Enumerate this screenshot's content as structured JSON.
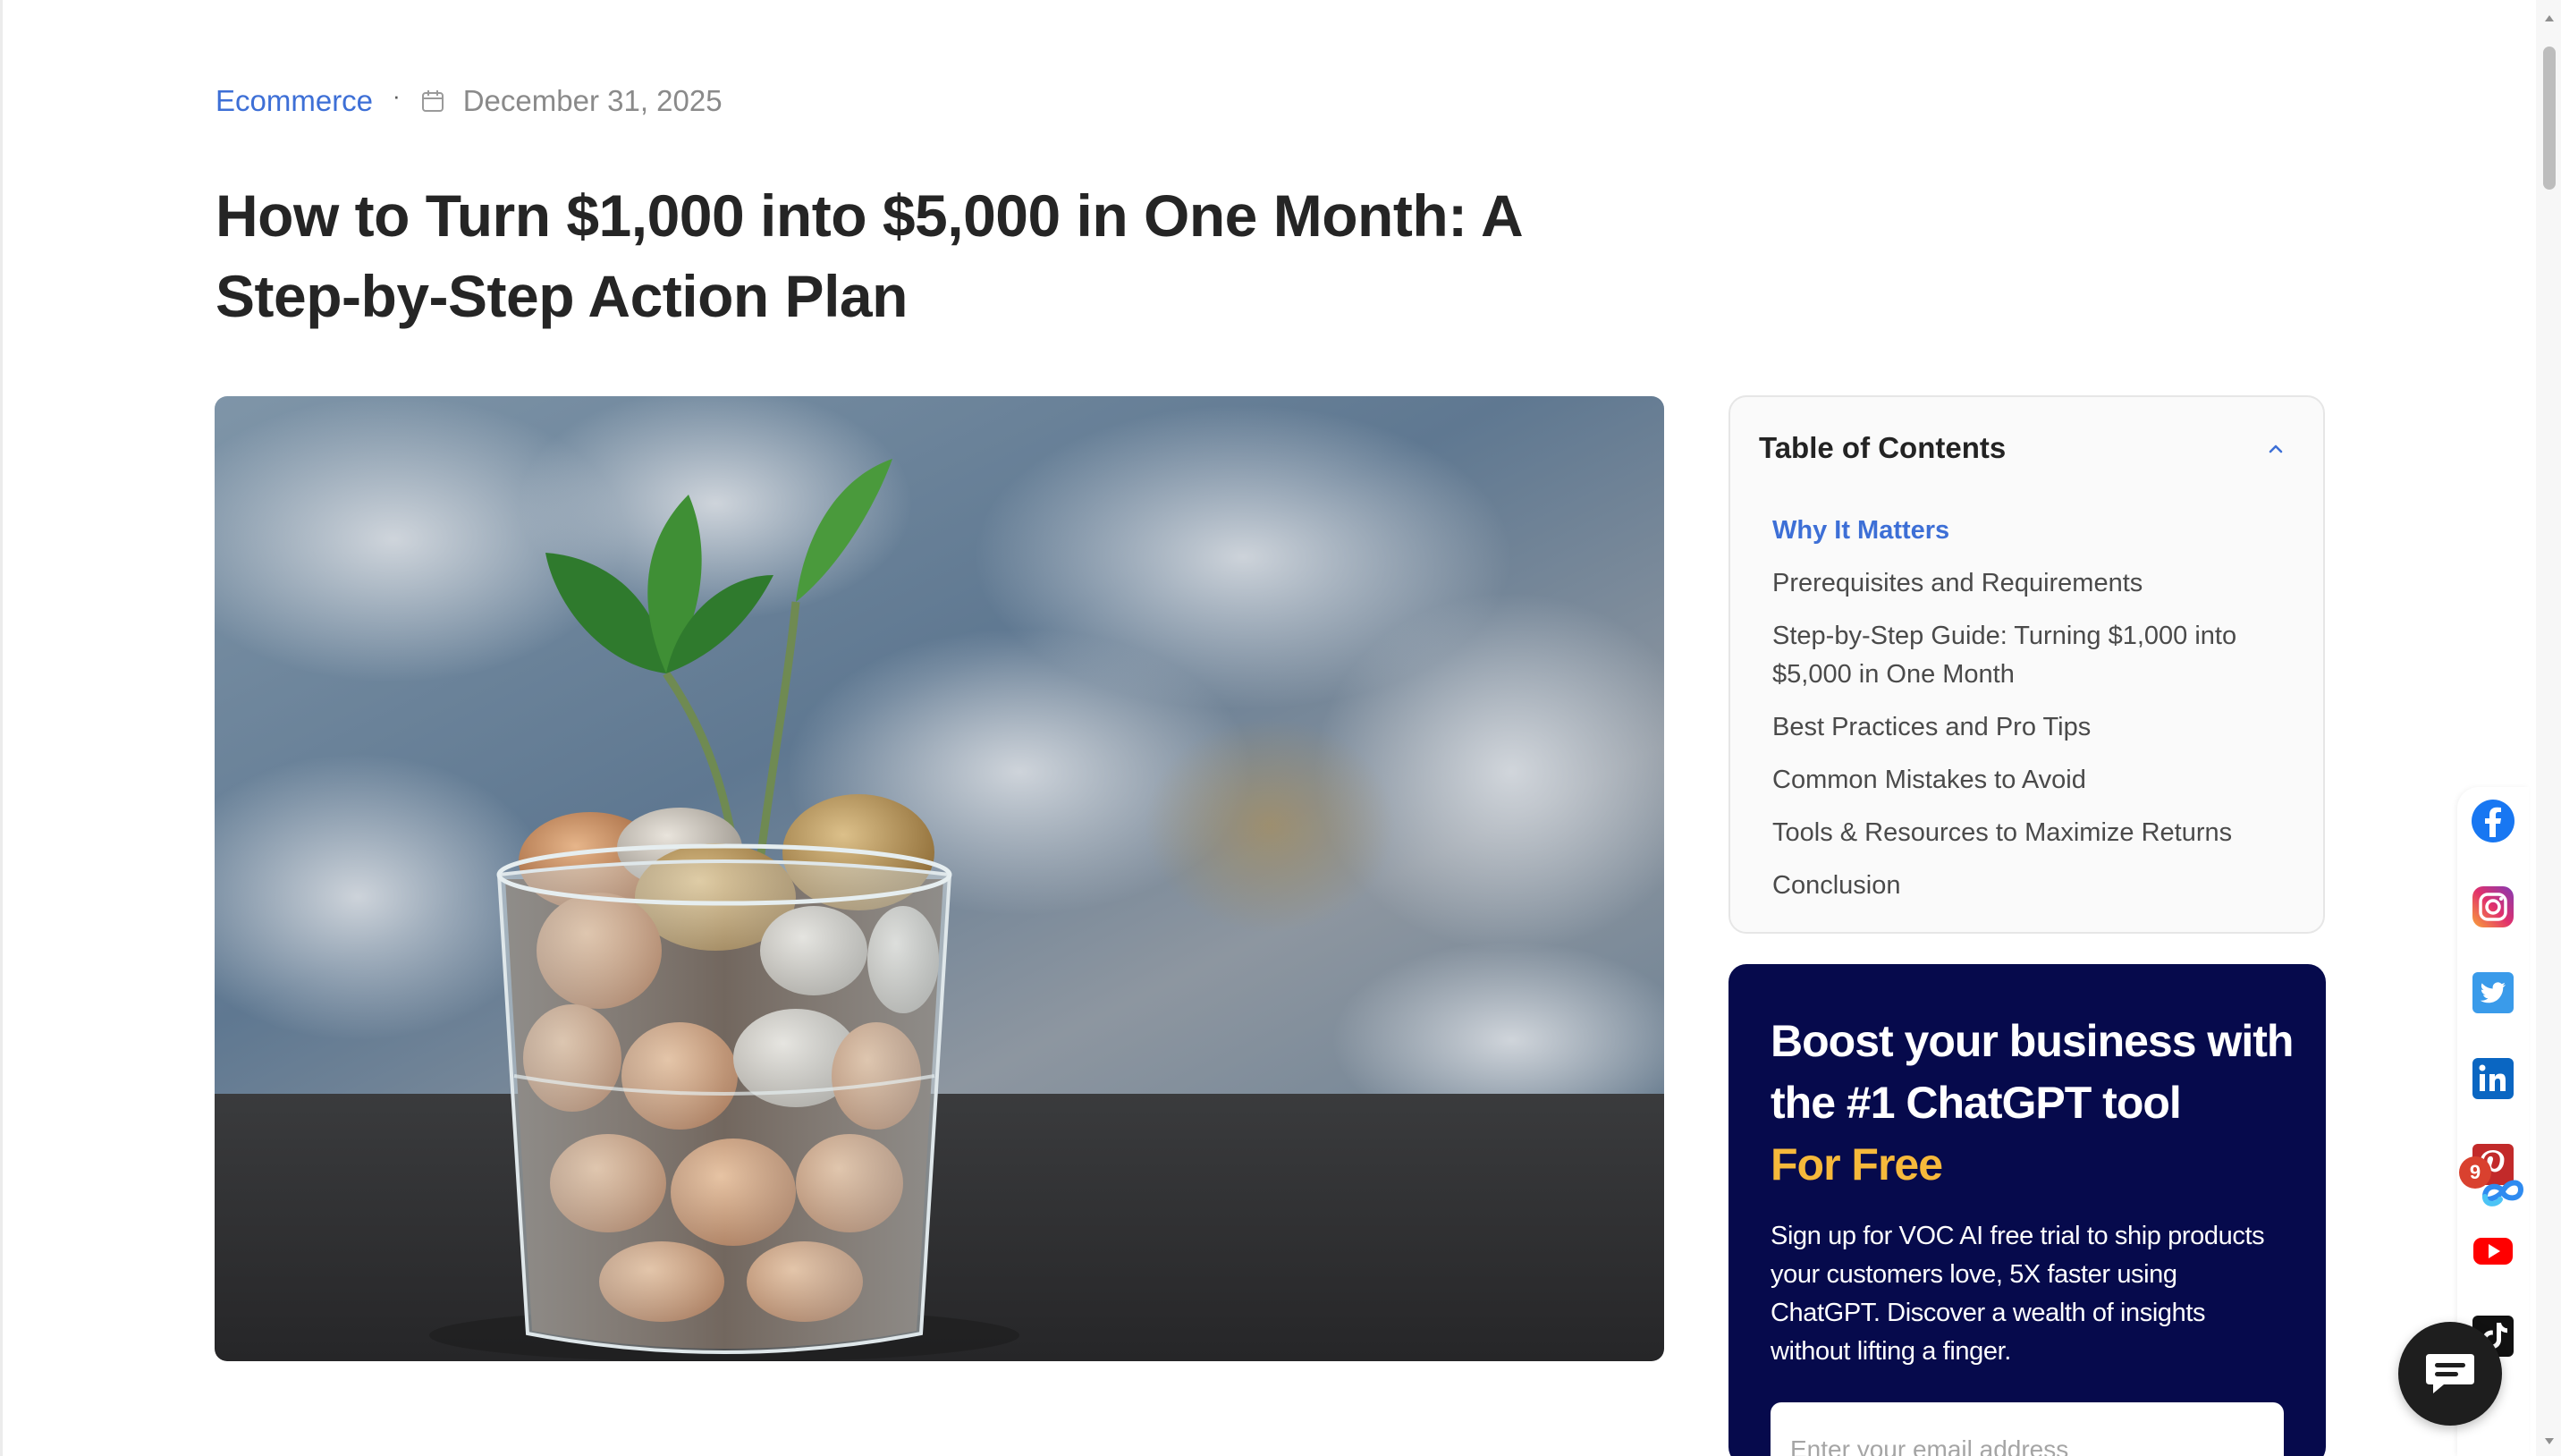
{
  "meta": {
    "category": "Ecommerce",
    "separator": "·",
    "date": "December 31, 2025"
  },
  "article": {
    "title": "How to Turn $1,000 into $5,000 in One Month: A Step-by-Step Action Plan"
  },
  "toc": {
    "heading": "Table of Contents",
    "items": [
      {
        "label": "Why It Matters",
        "active": true
      },
      {
        "label": "Prerequisites and Requirements",
        "active": false
      },
      {
        "label": "Step-by-Step Guide: Turning $1,000 into $5,000 in One Month",
        "active": false
      },
      {
        "label": "Best Practices and Pro Tips",
        "active": false
      },
      {
        "label": "Common Mistakes to Avoid",
        "active": false
      },
      {
        "label": "Tools & Resources to Maximize Returns",
        "active": false
      },
      {
        "label": "Conclusion",
        "active": false
      }
    ]
  },
  "promo": {
    "heading_line1": "Boost your business with the #1 ChatGPT tool",
    "heading_highlight": "For Free",
    "body": "Sign up for VOC AI free trial to ship products your customers love, 5X faster using ChatGPT. Discover a wealth of insights without lifting a finger.",
    "email_placeholder": "Enter your email address"
  },
  "social": {
    "icons": [
      "facebook-icon",
      "instagram-icon",
      "twitter-icon",
      "linkedin-icon",
      "pinterest-icon",
      "youtube-icon",
      "tiktok-icon"
    ],
    "notification_count": "9"
  },
  "colors": {
    "accent": "#3d6fd6",
    "promo_bg": "#060a4c",
    "promo_highlight": "#f6b93b"
  }
}
